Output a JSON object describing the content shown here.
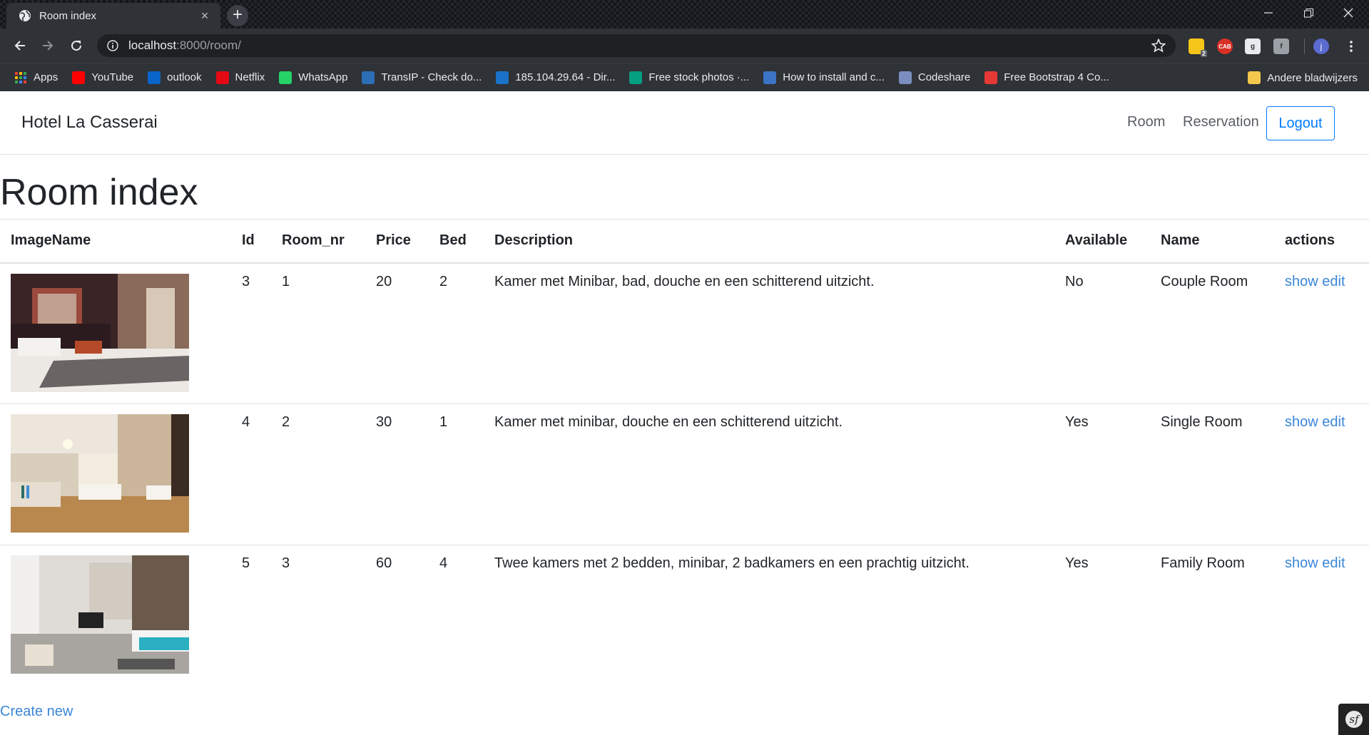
{
  "browser": {
    "tab_title": "Room index",
    "tab_close": "×",
    "new_tab": "+",
    "url_host": "localhost",
    "url_rest": ":8000/room/",
    "profile_initial": "j",
    "ext_badge": "2",
    "ext_cab": "CAB"
  },
  "bookmarks": [
    {
      "label": "Apps",
      "icon": "apps-grid-icon",
      "color": "#e8eaed"
    },
    {
      "label": "YouTube",
      "icon": "youtube-icon",
      "color": "#ff0000"
    },
    {
      "label": "outlook",
      "icon": "outlook-icon",
      "color": "#0a64c9"
    },
    {
      "label": "Netflix",
      "icon": "netflix-icon",
      "color": "#e50914"
    },
    {
      "label": "WhatsApp",
      "icon": "whatsapp-icon",
      "color": "#25d366"
    },
    {
      "label": "TransIP - Check do...",
      "icon": "transip-icon",
      "color": "#2d6fb7"
    },
    {
      "label": "185.104.29.64 - Dir...",
      "icon": "directadmin-icon",
      "color": "#1a73c9"
    },
    {
      "label": "Free stock photos ·...",
      "icon": "pexels-icon",
      "color": "#05a081"
    },
    {
      "label": "How to install and c...",
      "icon": "eye-icon",
      "color": "#3b74c7"
    },
    {
      "label": "Codeshare",
      "icon": "codeshare-icon",
      "color": "#7a8fbf"
    },
    {
      "label": "Free Bootstrap 4 Co...",
      "icon": "s-logo-icon",
      "color": "#e53935"
    }
  ],
  "bookmarks_other": "Andere bladwijzers",
  "site": {
    "brand": "Hotel La Casserai",
    "nav": [
      "Room",
      "Reservation"
    ],
    "logout": "Logout",
    "title": "Room index",
    "create_new": "Create new"
  },
  "table": {
    "headers": [
      "ImageName",
      "Id",
      "Room_nr",
      "Price",
      "Bed",
      "Description",
      "Available",
      "Name",
      "actions"
    ],
    "rows": [
      {
        "image": "bedroom-dark-headboard",
        "id": "3",
        "room_nr": "1",
        "price": "20",
        "bed": "2",
        "description": "Kamer met Minibar, bad, douche en een schitterend uitzicht.",
        "available": "No",
        "name": "Couple Room",
        "show": "show",
        "edit": "edit"
      },
      {
        "image": "bright-hotel-room",
        "id": "4",
        "room_nr": "2",
        "price": "30",
        "bed": "1",
        "description": "Kamer met minibar, douche en een schitterend uitzicht.",
        "available": "Yes",
        "name": "Single Room",
        "show": "show",
        "edit": "edit"
      },
      {
        "image": "family-suite-teal-bed",
        "id": "5",
        "room_nr": "3",
        "price": "60",
        "bed": "4",
        "description": "Twee kamers met 2 bedden, minibar, 2 badkamers en een prachtig uitzicht.",
        "available": "Yes",
        "name": "Family Room",
        "show": "show",
        "edit": "edit"
      }
    ]
  },
  "colors": {
    "link": "#3a86d8",
    "outline_primary": "#007bff",
    "chrome_dark": "#2f3237"
  }
}
